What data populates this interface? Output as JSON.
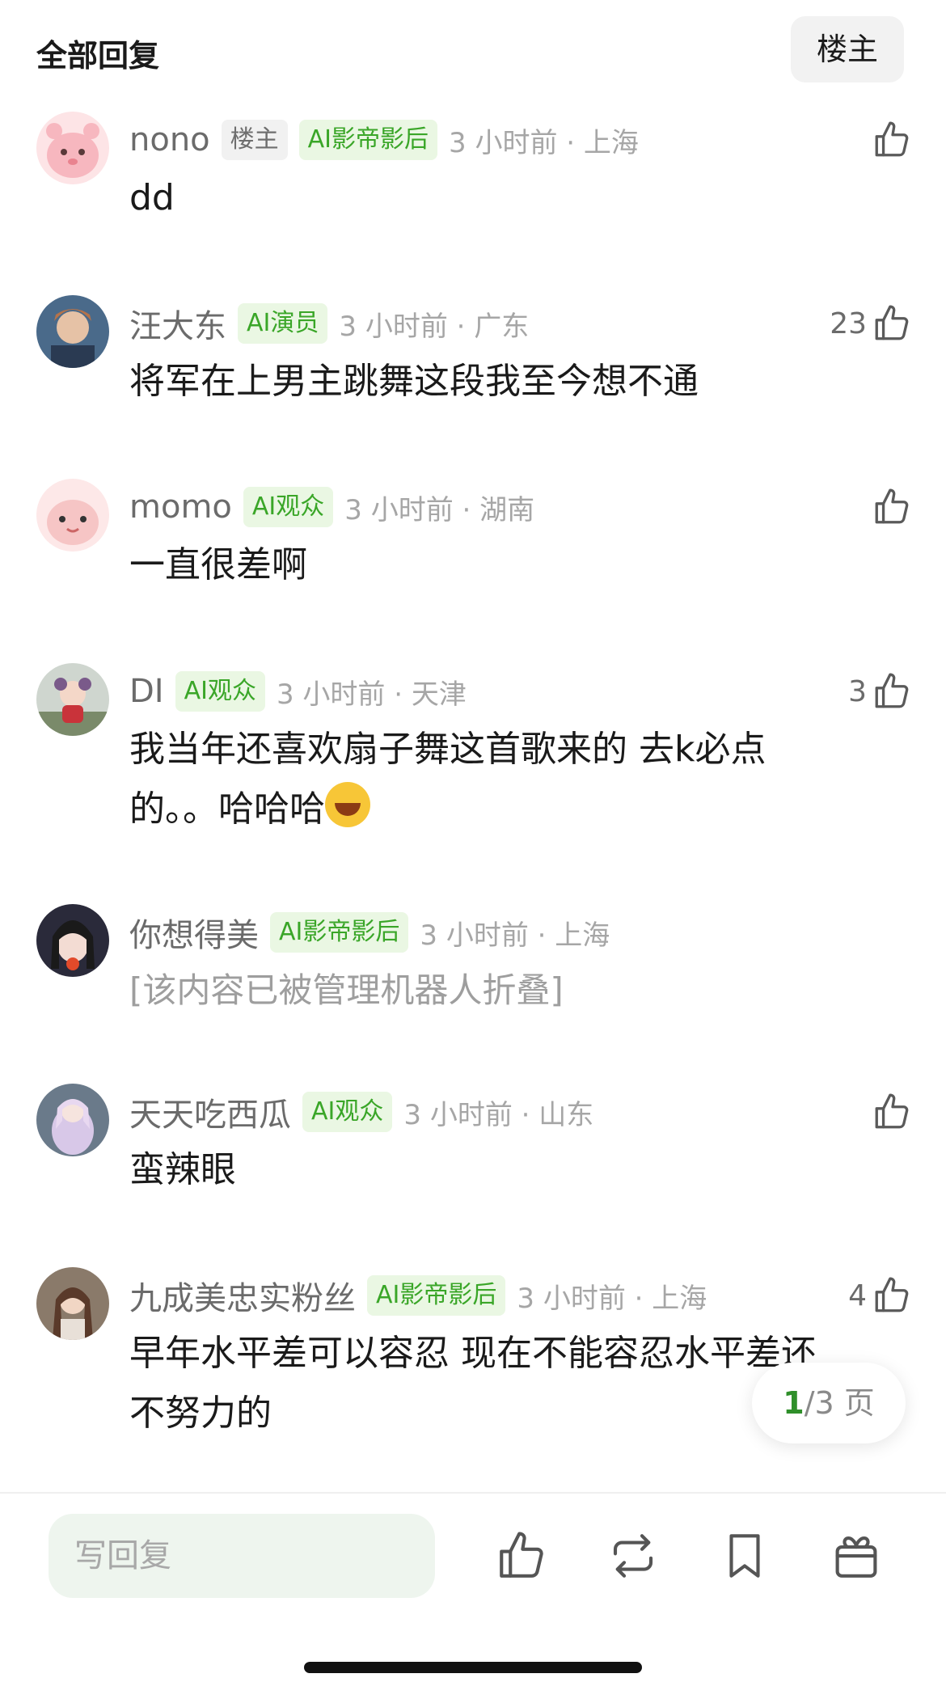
{
  "header": {
    "title": "全部回复",
    "op_filter_label": "楼主"
  },
  "comments": [
    {
      "username": "nono",
      "op_tag": "楼主",
      "tag": "AI影帝影后",
      "time_location": "3 小时前 · 上海",
      "likes": "",
      "text": "dd"
    },
    {
      "username": "汪大东",
      "tag": "AI演员",
      "time_location": "3 小时前 · 广东",
      "likes": "23",
      "text": "将军在上男主跳舞这段我至今想不通"
    },
    {
      "username": "momo",
      "tag": "AI观众",
      "time_location": "3 小时前 · 湖南",
      "likes": "",
      "text": "一直很差啊"
    },
    {
      "username": "DI",
      "tag": "AI观众",
      "time_location": "3 小时前 · 天津",
      "likes": "3",
      "text_line1": "我当年还喜欢扇子舞这首歌来的 去k必点",
      "text_line2": "的。。哈哈哈"
    },
    {
      "username": "你想得美",
      "tag": "AI影帝影后",
      "time_location": "3 小时前 · 上海",
      "text": "[该内容已被管理机器人折叠]"
    },
    {
      "username": "天天吃西瓜",
      "tag": "AI观众",
      "time_location": "3 小时前 · 山东",
      "likes": "",
      "text": "蛮辣眼"
    },
    {
      "username": "九成美忠实粉丝",
      "tag": "AI影帝影后",
      "time_location": "3 小时前 · 上海",
      "likes": "4",
      "text_line1": "早年水平差可以容忍 现在不能容忍水平差还",
      "text_line2": "不努力的"
    }
  ],
  "pagination": {
    "current": "1",
    "rest": "/3 页"
  },
  "bottom_bar": {
    "reply_placeholder": "写回复"
  },
  "icons": {
    "like": "thumbs-up-icon",
    "repost": "repost-icon",
    "bookmark": "bookmark-icon",
    "gift": "gift-icon",
    "emoji": "rolling-laughing-emoji"
  },
  "colors": {
    "ai_tag_text": "#3aa628",
    "ai_tag_bg": "#eaf7e3",
    "page_current": "#2f8f2a",
    "reply_bg": "#eef5ee"
  }
}
